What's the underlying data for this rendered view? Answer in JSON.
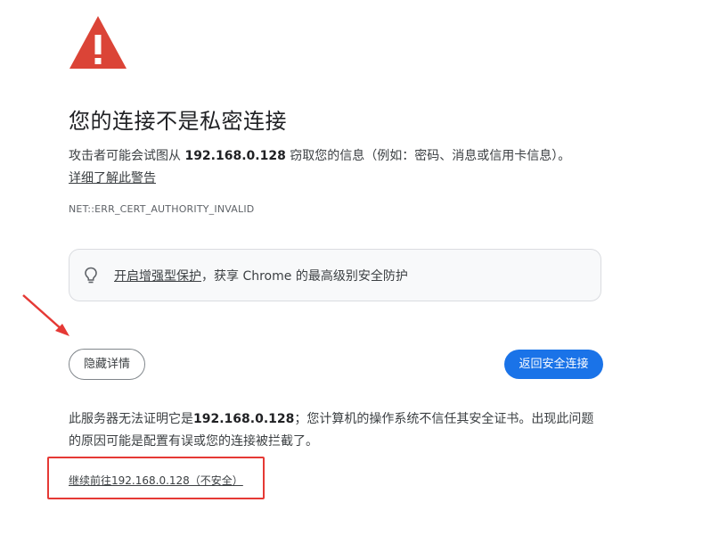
{
  "title": "您的连接不是私密连接",
  "description": {
    "prefix": "攻击者可能会试图从 ",
    "host": "192.168.0.128",
    "suffix": " 窃取您的信息（例如：密码、消息或信用卡信息）。"
  },
  "learn_more": "详细了解此警告",
  "error_code": "NET::ERR_CERT_AUTHORITY_INVALID",
  "protection": {
    "link": "开启增强型保护",
    "text": "，获享 Chrome 的最高级别安全防护",
    "icon": "lightbulb-icon"
  },
  "buttons": {
    "details": "隐藏详情",
    "back": "返回安全连接"
  },
  "explanation": {
    "prefix": "此服务器无法证明它是",
    "host": "192.168.0.128",
    "suffix": "；您计算机的操作系统不信任其安全证书。出现此问题的原因可能是配置有误或您的连接被拦截了。"
  },
  "proceed_link": "继续前往192.168.0.128（不安全）",
  "colors": {
    "warning_red": "#db4437",
    "primary_blue": "#1a73e8",
    "annotation_red": "#e53935"
  }
}
